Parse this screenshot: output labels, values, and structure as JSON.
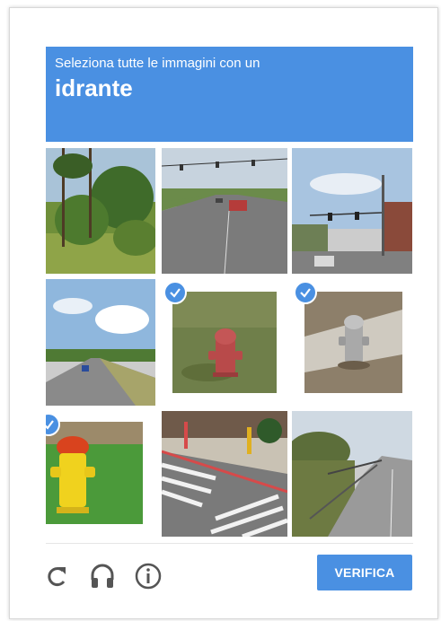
{
  "challenge": {
    "instruction": "Seleziona tutte le immagini con un",
    "target": "idrante"
  },
  "tiles": [
    {
      "scene": "field-trees",
      "selected": false
    },
    {
      "scene": "road-car",
      "selected": false
    },
    {
      "scene": "intersection",
      "selected": false
    },
    {
      "scene": "highway-sky",
      "selected": false
    },
    {
      "scene": "red-hydrant-grass",
      "selected": true
    },
    {
      "scene": "grey-hydrant-sidewalk",
      "selected": true
    },
    {
      "scene": "yellow-hydrant",
      "selected": true
    },
    {
      "scene": "crosswalk",
      "selected": false
    },
    {
      "scene": "road-fence",
      "selected": false
    }
  ],
  "footer": {
    "reload_icon": "reload-icon",
    "audio_icon": "headphones-icon",
    "info_icon": "info-icon",
    "verify_label": "VERIFICA"
  },
  "colors": {
    "accent": "#4a90e2",
    "icon": "#555555"
  }
}
